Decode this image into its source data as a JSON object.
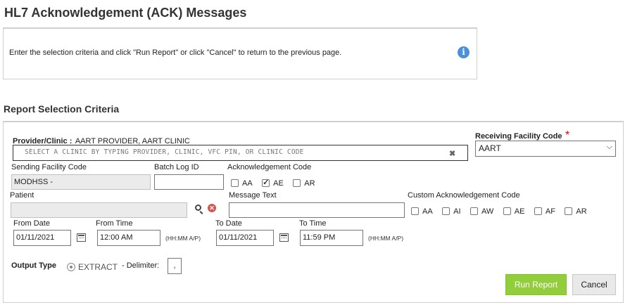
{
  "page": {
    "title": "HL7 Acknowledgement (ACK) Messages",
    "info_text": "Enter the selection criteria and click \"Run Report\" or click \"Cancel\" to return to the previous page.",
    "section_title": "Report Selection Criteria"
  },
  "form": {
    "provider_label": "Provider/Clinic :",
    "provider_value": "AART PROVIDER, AART CLINIC",
    "clinic_placeholder": "SELECT A CLINIC BY TYPING PROVIDER, CLINIC, VFC PIN, OR CLINIC CODE",
    "receiving_label": "Receiving Facility Code",
    "receiving_required": "*",
    "receiving_value": "AART",
    "sending_label": "Sending Facility Code",
    "sending_value": "MODHSS -",
    "batch_label": "Batch Log ID",
    "batch_value": "",
    "ack_label": "Acknowledgement Code",
    "ack_options": [
      {
        "label": "AA",
        "checked": false
      },
      {
        "label": "AE",
        "checked": true
      },
      {
        "label": "AR",
        "checked": false
      }
    ],
    "patient_label": "Patient",
    "patient_value": "",
    "message_label": "Message Text",
    "message_value": "",
    "custom_label": "Custom Acknowledgement Code",
    "custom_options": [
      {
        "label": "AA",
        "checked": false
      },
      {
        "label": "AI",
        "checked": false
      },
      {
        "label": "AW",
        "checked": false
      },
      {
        "label": "AE",
        "checked": false
      },
      {
        "label": "AF",
        "checked": false
      },
      {
        "label": "AR",
        "checked": false
      }
    ],
    "from_date_label": "From Date",
    "from_date_value": "01/11/2021",
    "from_time_label": "From Time",
    "from_time_value": "12:00 AM",
    "to_date_label": "To Date",
    "to_date_value": "01/11/2021",
    "to_time_label": "To Time",
    "to_time_value": "11:59 PM",
    "time_hint": "(HH:MM A/P)",
    "output_label": "Output Type",
    "output_option": "EXTRACT",
    "delimiter_label": "- Delimiter:",
    "delimiter_value": ","
  },
  "buttons": {
    "run": "Run Report",
    "cancel": "Cancel"
  },
  "icons": {
    "info": "info-icon",
    "calendar": "calendar-icon",
    "search": "search-icon",
    "clear": "clear-icon"
  },
  "colors": {
    "run_button": "#92cd3c",
    "info_icon": "#4a90d9",
    "clear_icon": "#d9534f"
  }
}
